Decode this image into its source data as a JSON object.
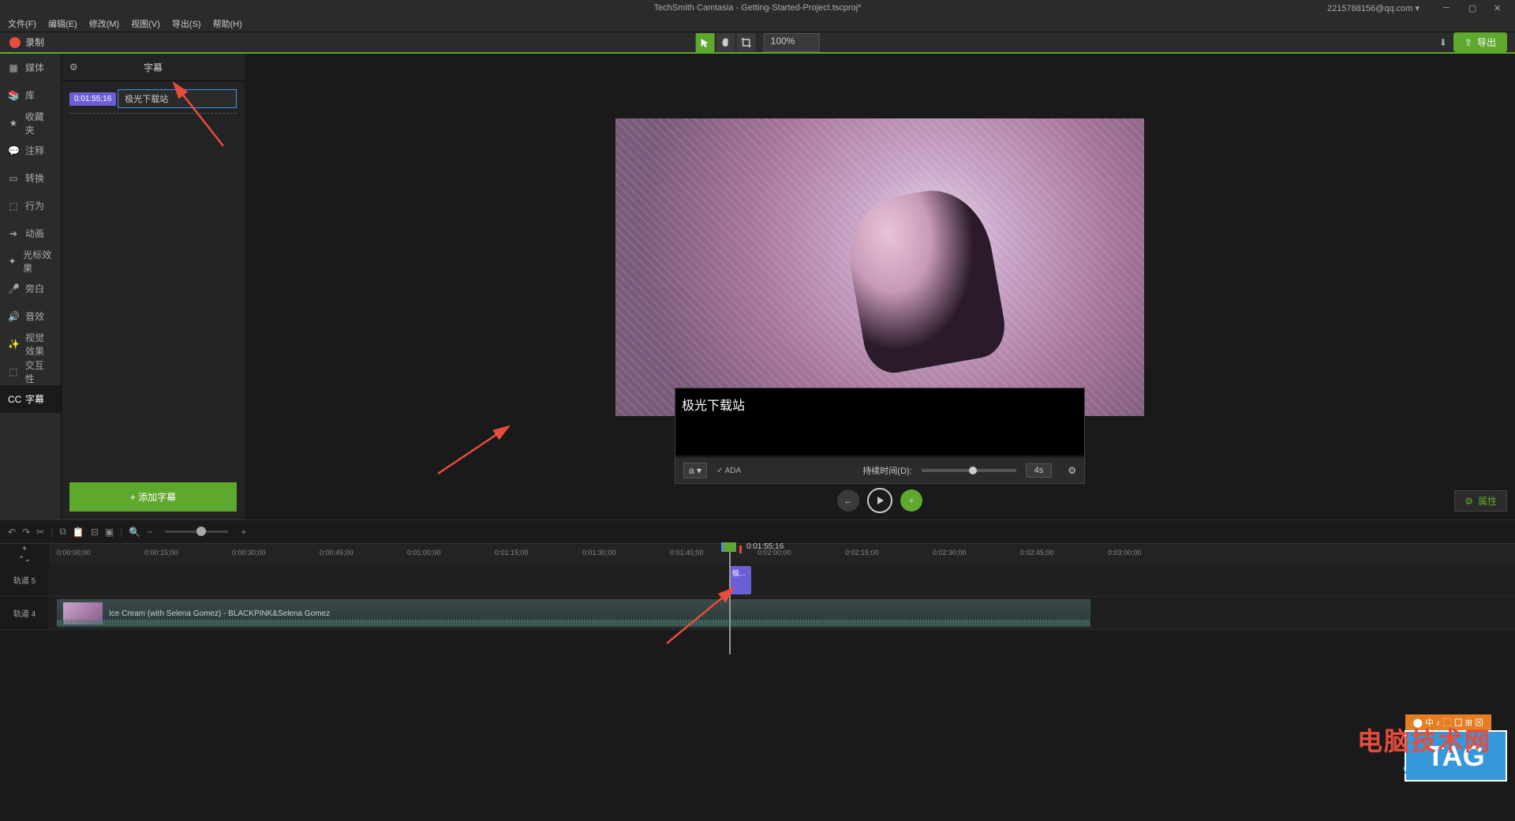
{
  "titlebar": {
    "title": "TechSmith Camtasia - Getting-Started-Project.tscproj*",
    "account": "2215788156@qq.com ▾"
  },
  "menus": [
    "文件(F)",
    "编辑(E)",
    "修改(M)",
    "视图(V)",
    "导出(S)",
    "帮助(H)"
  ],
  "toolbar": {
    "record": "录制",
    "zoom": "100%",
    "export": "导出"
  },
  "sidebar": {
    "items": [
      {
        "icon": "▦",
        "label": "媒体"
      },
      {
        "icon": "📚",
        "label": "库"
      },
      {
        "icon": "★",
        "label": "收藏夹"
      },
      {
        "icon": "💬",
        "label": "注释"
      },
      {
        "icon": "▭",
        "label": "转换"
      },
      {
        "icon": "⬚",
        "label": "行为"
      },
      {
        "icon": "➔",
        "label": "动画"
      },
      {
        "icon": "✦",
        "label": "光标效果"
      },
      {
        "icon": "🎤",
        "label": "旁白"
      },
      {
        "icon": "🔊",
        "label": "音效"
      },
      {
        "icon": "✨",
        "label": "视觉效果"
      },
      {
        "icon": "⬚",
        "label": "交互性"
      },
      {
        "icon": "CC",
        "label": "字幕"
      }
    ]
  },
  "panel": {
    "title": "字幕",
    "caption_time": "0:01:55;16",
    "caption_text": "极光下载站",
    "add_caption": "+ 添加字幕"
  },
  "editor": {
    "caption_value": "极光下载站",
    "ada": "✓ ADA",
    "duration_label": "持续时间(D):",
    "duration_value": "4s",
    "font_btn": "a ▾"
  },
  "properties_btn": "属性",
  "timeline": {
    "ticks": [
      "0:00:00;00",
      "0:00:15;00",
      "0:00:30;00",
      "0:00:45;00",
      "0:01:00;00",
      "0:01:15;00",
      "0:01:30;00",
      "0:01:45;00",
      "0:02:00;00",
      "0:02:15;00",
      "0:02:30;00",
      "0:02:45;00",
      "0:03:00;00"
    ],
    "playhead_time": "0:01:55;16",
    "track5": "轨道 5",
    "track4": "轨道 4",
    "caption_clip": "极...",
    "video_clip": "Ice Cream (with Selena Gomez) - BLACKPINK&Selena Gomez"
  },
  "watermarks": {
    "top_bar": "⬤ 中 ♪ ⬚ 囗 ⊞ ⊠",
    "main": "电脑技术网",
    "sub": "www.tagxp.com",
    "tag": "TAG"
  }
}
